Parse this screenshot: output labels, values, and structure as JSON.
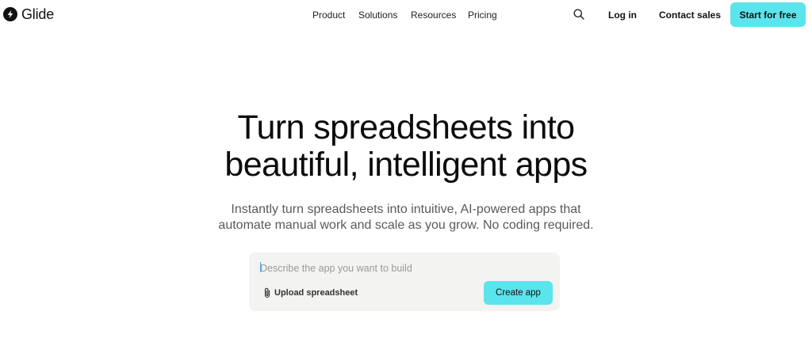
{
  "brand": {
    "name": "Glide",
    "logo_icon": "glide-bolt-icon"
  },
  "nav": {
    "items": [
      {
        "label": "Product"
      },
      {
        "label": "Solutions"
      },
      {
        "label": "Resources"
      },
      {
        "label": "Pricing"
      }
    ],
    "search_icon": "search-icon",
    "login_label": "Log in",
    "contact_label": "Contact sales",
    "cta_label": "Start for free"
  },
  "hero": {
    "title_line1": "Turn spreadsheets into",
    "title_line2": "beautiful, intelligent apps",
    "subtitle_line1": "Instantly turn spreadsheets into intuitive, AI-powered apps that",
    "subtitle_line2": "automate manual work and scale as you grow. No coding required."
  },
  "prompt": {
    "placeholder": "Describe the app you want to build",
    "value": "",
    "upload_label": "Upload spreadsheet",
    "upload_icon": "paperclip-icon",
    "create_label": "Create app"
  },
  "colors": {
    "accent": "#5ce4ec",
    "text": "#111111",
    "subtitle": "#5a5a5a",
    "prompt_bg": "#f3f3f1"
  }
}
